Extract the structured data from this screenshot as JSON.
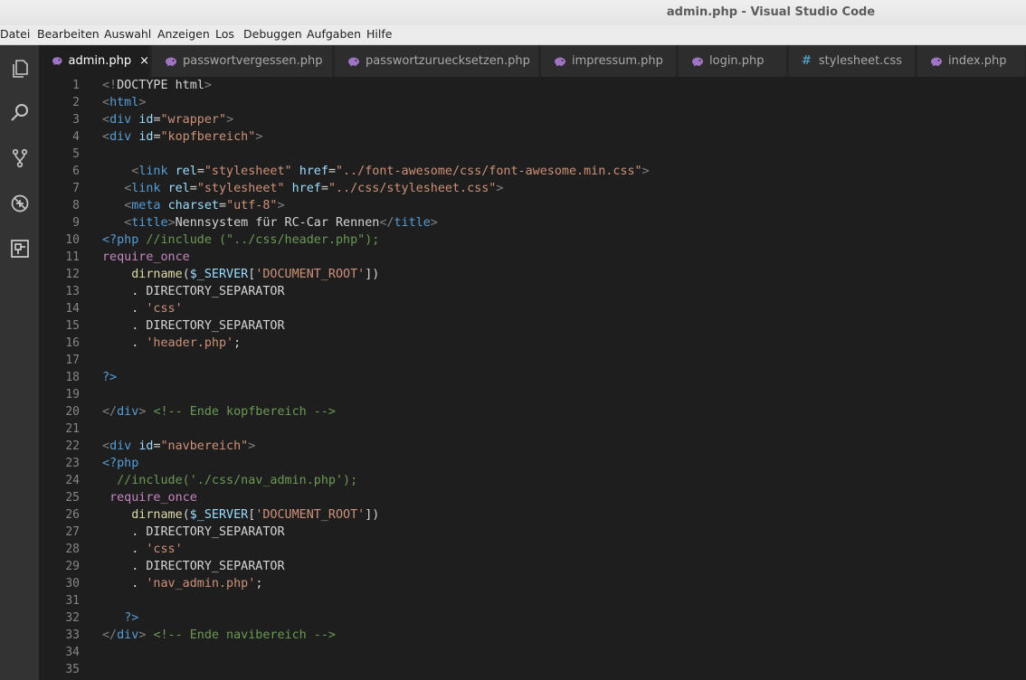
{
  "window": {
    "title": "admin.php - Visual Studio Code"
  },
  "menu": [
    "Datei",
    "Bearbeiten",
    "Auswahl",
    "Anzeigen",
    "Los",
    "Debuggen",
    "Aufgaben",
    "Hilfe"
  ],
  "activity_bar": [
    "explorer-icon",
    "search-icon",
    "source-control-icon",
    "debug-icon",
    "extensions-icon"
  ],
  "tabs": [
    {
      "label": "admin.php",
      "icon": "php-icon",
      "active": true,
      "close": "×"
    },
    {
      "label": "passwortvergessen.php",
      "icon": "php-icon"
    },
    {
      "label": "passwortzuruecksetzen.php",
      "icon": "php-icon"
    },
    {
      "label": "impressum.php",
      "icon": "php-icon"
    },
    {
      "label": "login.php",
      "icon": "php-icon"
    },
    {
      "label": "stylesheet.css",
      "icon": "css-hash-icon",
      "glyph": "#"
    },
    {
      "label": "index.php",
      "icon": "php-icon"
    }
  ],
  "line_numbers": [
    "1",
    "2",
    "3",
    "4",
    "5",
    "6",
    "7",
    "8",
    "9",
    "10",
    "11",
    "12",
    "13",
    "14",
    "15",
    "16",
    "17",
    "18",
    "19",
    "20",
    "21",
    "22",
    "23",
    "24",
    "25",
    "26",
    "27",
    "28",
    "29",
    "30",
    "31",
    "32",
    "33",
    "34",
    "35"
  ],
  "code_lines": [
    [
      {
        "t": "p",
        "v": "<!"
      },
      {
        "t": "tx",
        "v": "DOCTYPE html"
      },
      {
        "t": "p",
        "v": ">"
      }
    ],
    [
      {
        "t": "p",
        "v": "<"
      },
      {
        "t": "t",
        "v": "html"
      },
      {
        "t": "p",
        "v": ">"
      }
    ],
    [
      {
        "t": "p",
        "v": "<"
      },
      {
        "t": "t",
        "v": "div"
      },
      {
        "t": "tx",
        "v": " "
      },
      {
        "t": "a",
        "v": "id"
      },
      {
        "t": "tx",
        "v": "="
      },
      {
        "t": "s",
        "v": "\"wrapper\""
      },
      {
        "t": "p",
        "v": ">"
      }
    ],
    [
      {
        "t": "p",
        "v": "<"
      },
      {
        "t": "t",
        "v": "div"
      },
      {
        "t": "tx",
        "v": " "
      },
      {
        "t": "a",
        "v": "id"
      },
      {
        "t": "tx",
        "v": "="
      },
      {
        "t": "s",
        "v": "\"kopfbereich\""
      },
      {
        "t": "p",
        "v": ">"
      }
    ],
    [],
    [
      {
        "t": "tx",
        "v": "    "
      },
      {
        "t": "p",
        "v": "<"
      },
      {
        "t": "t",
        "v": "link"
      },
      {
        "t": "tx",
        "v": " "
      },
      {
        "t": "a",
        "v": "rel"
      },
      {
        "t": "tx",
        "v": "="
      },
      {
        "t": "s",
        "v": "\"stylesheet\""
      },
      {
        "t": "tx",
        "v": " "
      },
      {
        "t": "a",
        "v": "href"
      },
      {
        "t": "tx",
        "v": "="
      },
      {
        "t": "s",
        "v": "\"../font-awesome/css/font-awesome.min.css\""
      },
      {
        "t": "p",
        "v": ">"
      }
    ],
    [
      {
        "t": "tx",
        "v": "   "
      },
      {
        "t": "p",
        "v": "<"
      },
      {
        "t": "t",
        "v": "link"
      },
      {
        "t": "tx",
        "v": " "
      },
      {
        "t": "a",
        "v": "rel"
      },
      {
        "t": "tx",
        "v": "="
      },
      {
        "t": "s",
        "v": "\"stylesheet\""
      },
      {
        "t": "tx",
        "v": " "
      },
      {
        "t": "a",
        "v": "href"
      },
      {
        "t": "tx",
        "v": "="
      },
      {
        "t": "s",
        "v": "\"../css/stylesheet.css\""
      },
      {
        "t": "p",
        "v": ">"
      }
    ],
    [
      {
        "t": "tx",
        "v": "   "
      },
      {
        "t": "p",
        "v": "<"
      },
      {
        "t": "t",
        "v": "meta"
      },
      {
        "t": "tx",
        "v": " "
      },
      {
        "t": "a",
        "v": "charset"
      },
      {
        "t": "tx",
        "v": "="
      },
      {
        "t": "s",
        "v": "\"utf-8\""
      },
      {
        "t": "p",
        "v": ">"
      }
    ],
    [
      {
        "t": "tx",
        "v": "   "
      },
      {
        "t": "p",
        "v": "<"
      },
      {
        "t": "t",
        "v": "title"
      },
      {
        "t": "p",
        "v": ">"
      },
      {
        "t": "tx",
        "v": "Nennsystem für RC-Car Rennen"
      },
      {
        "t": "p",
        "v": "</"
      },
      {
        "t": "t",
        "v": "title"
      },
      {
        "t": "p",
        "v": ">"
      }
    ],
    [
      {
        "t": "t",
        "v": "<?php"
      },
      {
        "t": "tx",
        "v": " "
      },
      {
        "t": "c",
        "v": "//include (\"../css/header.php\");"
      }
    ],
    [
      {
        "t": "k",
        "v": "require_once"
      }
    ],
    [
      {
        "t": "tx",
        "v": "    "
      },
      {
        "t": "f",
        "v": "dirname"
      },
      {
        "t": "tx",
        "v": "("
      },
      {
        "t": "v",
        "v": "$_SERVER"
      },
      {
        "t": "tx",
        "v": "["
      },
      {
        "t": "s",
        "v": "'DOCUMENT_ROOT'"
      },
      {
        "t": "tx",
        "v": "])"
      }
    ],
    [
      {
        "t": "tx",
        "v": "    . DIRECTORY_SEPARATOR"
      }
    ],
    [
      {
        "t": "tx",
        "v": "    . "
      },
      {
        "t": "s",
        "v": "'css'"
      }
    ],
    [
      {
        "t": "tx",
        "v": "    . DIRECTORY_SEPARATOR"
      }
    ],
    [
      {
        "t": "tx",
        "v": "    . "
      },
      {
        "t": "s",
        "v": "'header.php'"
      },
      {
        "t": "tx",
        "v": ";"
      }
    ],
    [],
    [
      {
        "t": "t",
        "v": "?>"
      }
    ],
    [],
    [
      {
        "t": "p",
        "v": "</"
      },
      {
        "t": "t",
        "v": "div"
      },
      {
        "t": "p",
        "v": ">"
      },
      {
        "t": "tx",
        "v": " "
      },
      {
        "t": "c",
        "v": "<!-- Ende kopfbereich -->"
      }
    ],
    [],
    [
      {
        "t": "p",
        "v": "<"
      },
      {
        "t": "t",
        "v": "div"
      },
      {
        "t": "tx",
        "v": " "
      },
      {
        "t": "a",
        "v": "id"
      },
      {
        "t": "tx",
        "v": "="
      },
      {
        "t": "s",
        "v": "\"navbereich\""
      },
      {
        "t": "p",
        "v": ">"
      }
    ],
    [
      {
        "t": "t",
        "v": "<?php"
      }
    ],
    [
      {
        "t": "tx",
        "v": "  "
      },
      {
        "t": "c",
        "v": "//include('./css/nav_admin.php');"
      }
    ],
    [
      {
        "t": "tx",
        "v": " "
      },
      {
        "t": "k",
        "v": "require_once"
      }
    ],
    [
      {
        "t": "tx",
        "v": "    "
      },
      {
        "t": "f",
        "v": "dirname"
      },
      {
        "t": "tx",
        "v": "("
      },
      {
        "t": "v",
        "v": "$_SERVER"
      },
      {
        "t": "tx",
        "v": "["
      },
      {
        "t": "s",
        "v": "'DOCUMENT_ROOT'"
      },
      {
        "t": "tx",
        "v": "])"
      }
    ],
    [
      {
        "t": "tx",
        "v": "    . DIRECTORY_SEPARATOR"
      }
    ],
    [
      {
        "t": "tx",
        "v": "    . "
      },
      {
        "t": "s",
        "v": "'css'"
      }
    ],
    [
      {
        "t": "tx",
        "v": "    . DIRECTORY_SEPARATOR"
      }
    ],
    [
      {
        "t": "tx",
        "v": "    . "
      },
      {
        "t": "s",
        "v": "'nav_admin.php'"
      },
      {
        "t": "tx",
        "v": ";"
      }
    ],
    [],
    [
      {
        "t": "tx",
        "v": "   "
      },
      {
        "t": "t",
        "v": "?>"
      }
    ],
    [
      {
        "t": "p",
        "v": "</"
      },
      {
        "t": "t",
        "v": "div"
      },
      {
        "t": "p",
        "v": ">"
      },
      {
        "t": "tx",
        "v": " "
      },
      {
        "t": "c",
        "v": "<!-- Ende navibereich -->"
      }
    ],
    [],
    []
  ],
  "colors": {
    "php_icon": "#a074c4",
    "css_icon": "#519aba",
    "editor_bg": "#1e1e1e"
  }
}
